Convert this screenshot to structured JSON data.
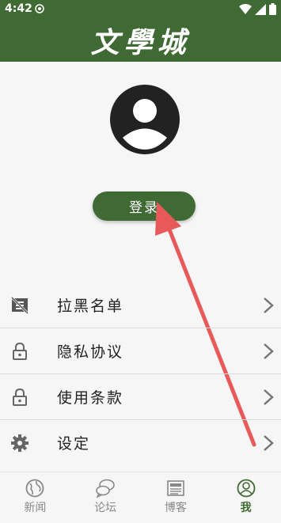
{
  "statusbar": {
    "time": "4:42"
  },
  "header": {
    "title": "文學城"
  },
  "profile": {
    "login_label": "登录"
  },
  "menu": {
    "items": [
      {
        "label": "拉黑名单",
        "icon": "blocklist-icon"
      },
      {
        "label": "隐私协议",
        "icon": "lock-icon"
      },
      {
        "label": "使用条款",
        "icon": "lock-icon"
      },
      {
        "label": "设定",
        "icon": "gear-icon"
      }
    ]
  },
  "bottom_nav": {
    "items": [
      {
        "label": "新闻",
        "icon": "globe-icon"
      },
      {
        "label": "论坛",
        "icon": "chat-bubbles-icon"
      },
      {
        "label": "博客",
        "icon": "newspaper-icon"
      },
      {
        "label": "我",
        "icon": "person-icon",
        "active": true
      }
    ]
  },
  "colors": {
    "brand": "#3f6a33",
    "annotation_arrow": "#e85a5a"
  }
}
